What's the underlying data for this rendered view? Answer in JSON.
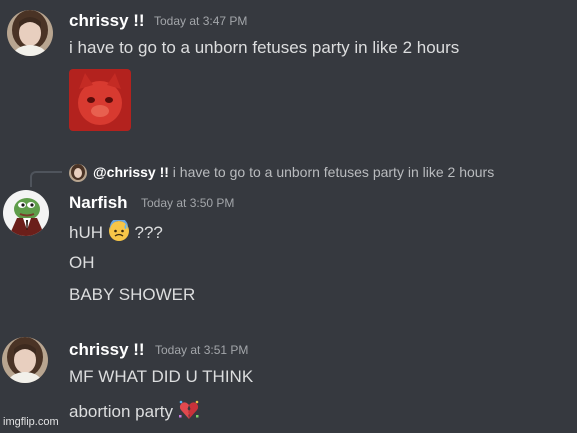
{
  "messages": [
    {
      "author": "chrissy !!",
      "time": "Today at 3:47 PM",
      "lines": [
        "i have to go to a unborn fetuses party in like 2 hours"
      ]
    },
    {
      "reply_to": {
        "mention": "@chrissy !!",
        "text": "i have to go to a unborn fetuses party in like 2 hours"
      },
      "author": "Narfish",
      "time": "Today at 3:50 PM",
      "lines": [
        "hUH",
        "???",
        "OH",
        "BABY SHOWER"
      ]
    },
    {
      "author": "chrissy !!",
      "time": "Today at 3:51 PM",
      "lines": [
        "MF WHAT DID U THINK",
        "abortion party"
      ]
    }
  ],
  "watermark": "imgflip.com",
  "icons": {
    "attachment": "red-cat-image",
    "reply_emoji": "anxious-face-with-sweat-icon",
    "party_emoji": "broken-heart-party-icon"
  },
  "colors": {
    "background": "#36393f",
    "username": "#ffffff",
    "message_text": "#dcddde",
    "timestamp": "#a3a6aa"
  }
}
